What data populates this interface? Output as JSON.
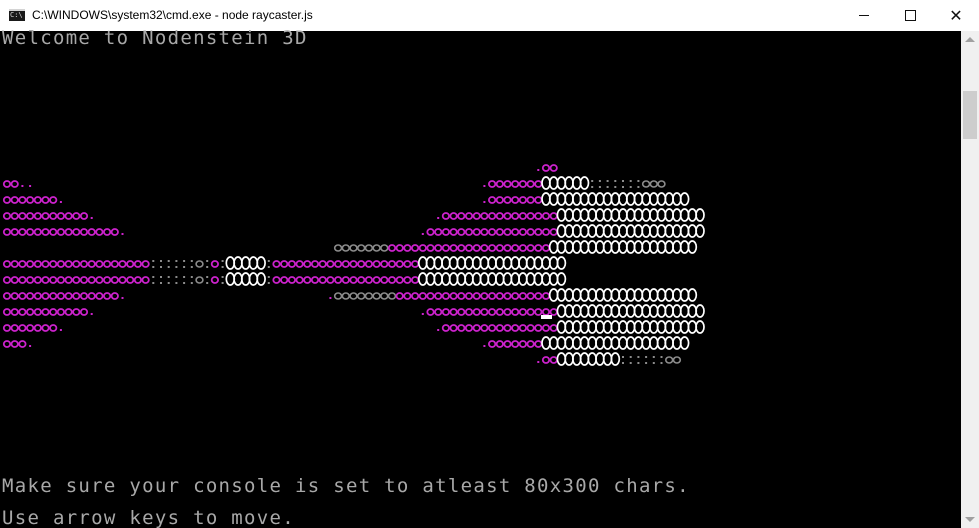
{
  "window": {
    "title": "C:\\WINDOWS\\system32\\cmd.exe - node  raycaster.js",
    "icon": "cmd-console-icon",
    "icon_label": "C:\\",
    "controls": [
      "minimize-icon",
      "maximize-icon",
      "close-icon"
    ],
    "close_glyph": "✕"
  },
  "console": {
    "welcome": "Welcome to Nodenstein 3D",
    "hint_console_size": "Make sure your console is set to atleast 80x300 chars.",
    "hint_controls": "Use arrow keys to move."
  },
  "colors": {
    "text_gray": "#a8a8a8",
    "wall_magenta": "#cc22cc",
    "wall_white": "#ffffff",
    "wall_gray": "#8c8c8c",
    "background": "#000000",
    "cursor": "#ffffff"
  },
  "render_view": {
    "description_icon": "raycaster-ascii-render"
  }
}
